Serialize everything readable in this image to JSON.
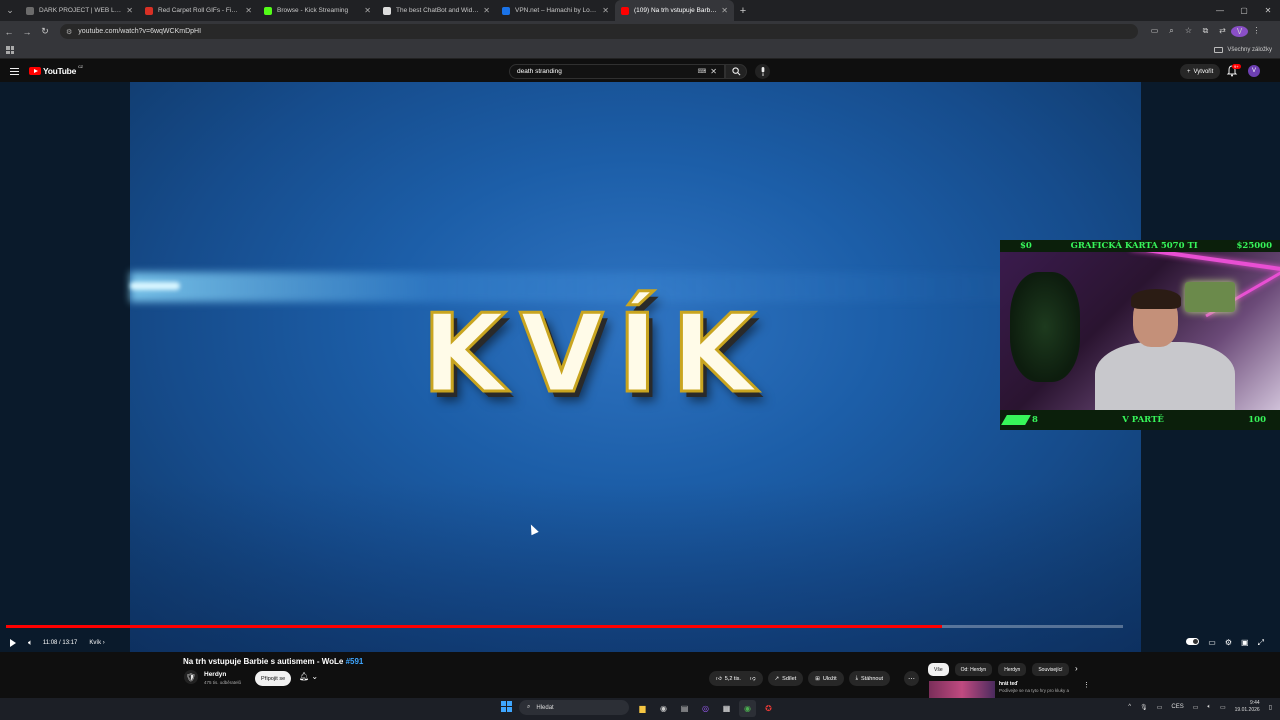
{
  "browser": {
    "tabs": [
      {
        "title": "DARK PROJECT | WEB LAB",
        "color": "#6b6b6b",
        "active": false
      },
      {
        "title": "Red Carpet Roll GIFs - Find & S",
        "color": "#d93025",
        "active": false
      },
      {
        "title": "Browse - Kick Streaming",
        "color": "#53fc18",
        "active": false
      },
      {
        "title": "The best ChatBot and Widgets",
        "color": "#dddddd",
        "active": false
      },
      {
        "title": "VPN.net – Hamachi by LogMeIn",
        "color": "#1a73e8",
        "active": false
      },
      {
        "title": "(109) Na trh vstupuje Barbie s a",
        "color": "#ff0000",
        "active": true
      }
    ],
    "url": "youtube.com/watch?v=6wqWCKmDpHI",
    "profile_initial": "V",
    "bookmarks_label": "Všechny záložky"
  },
  "youtube": {
    "logo_text": "YouTube",
    "logo_suffix": "CZ",
    "search_value": "death stranding",
    "create_label": "Vytvořit",
    "notif_count": "9+",
    "avatar_initial": "V"
  },
  "video": {
    "title_text": "KVÍK",
    "time": "11:08 / 13:17",
    "chapter": "Kvík",
    "progress_fraction": 0.838,
    "overlay": {
      "top_left": "$0",
      "top_center": "GRAFICKÁ KARTA 5070 TI",
      "top_right": "$25000",
      "bottom_left": "8",
      "bottom_center": "V PARTĚ",
      "bottom_right": "100"
    }
  },
  "below": {
    "title": "Na trh vstupuje Barbie s autismem - WoLe ",
    "title_hashtag": "#591",
    "channel": "Herdyn",
    "subs": "475 tis. odběratelů",
    "join": "Připojit se",
    "likes": "5,2 tis.",
    "share": "Sdílet",
    "save": "Uložit",
    "download": "Stáhnout",
    "chips": [
      "Vše",
      "Od: Herdyn",
      "Herdyn",
      "Související"
    ],
    "rec_title": "hrát teď",
    "rec_sub": "Podívejte se na tyto hry pro kluky a"
  },
  "taskbar": {
    "search": "Hledat",
    "lang": "CES",
    "time": "9:44",
    "date": "19.01.2026"
  }
}
